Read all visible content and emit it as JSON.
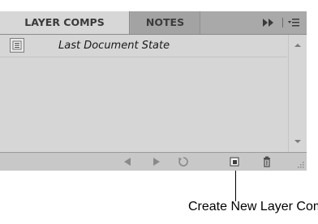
{
  "panel": {
    "tabs": [
      {
        "label": "LAYER COMPS",
        "active": true
      },
      {
        "label": "NOTES",
        "active": false
      }
    ],
    "header_icons": [
      "fast-forward-icon",
      "panel-menu-icon"
    ],
    "rows": [
      {
        "label": "Last Document State",
        "icon": "layer-comp-icon"
      }
    ],
    "bottom_buttons": [
      {
        "name": "previous-comp-icon"
      },
      {
        "name": "next-comp-icon"
      },
      {
        "name": "update-comp-icon"
      },
      {
        "name": "new-layer-comp-icon"
      },
      {
        "name": "delete-icon"
      }
    ]
  },
  "callout": {
    "text": "Create New Layer Comp"
  },
  "colors": {
    "active_tab": "#d7d7d7",
    "inactive_tab": "#a3a3a3",
    "content_bg": "#d6d6d6",
    "bottom_bar": "#c8c8c8"
  }
}
